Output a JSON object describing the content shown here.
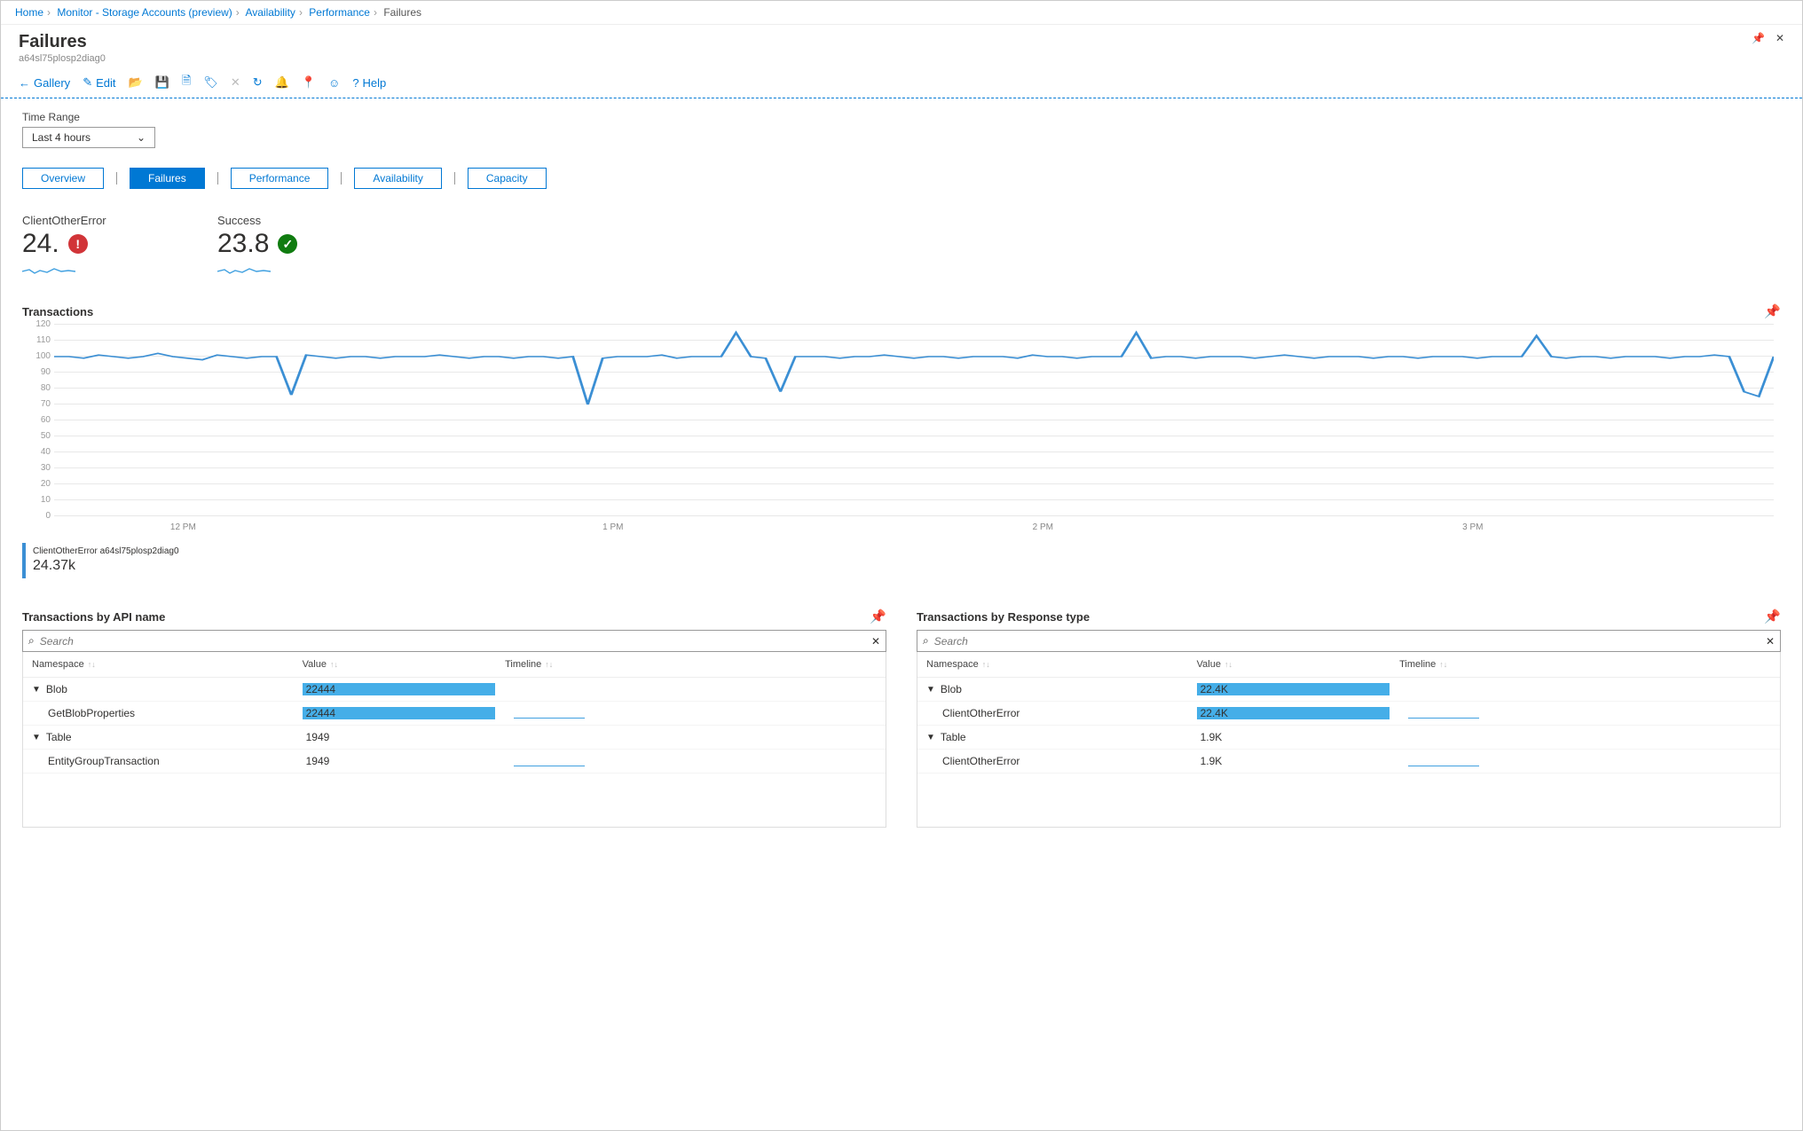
{
  "breadcrumb": [
    "Home",
    "Monitor - Storage Accounts (preview)",
    "Availability",
    "Performance",
    "Failures"
  ],
  "page": {
    "title": "Failures",
    "subtitle": "a64sl75plosp2diag0"
  },
  "toolbar": {
    "gallery": "Gallery",
    "edit": "Edit",
    "help": "Help"
  },
  "timeRange": {
    "label": "Time Range",
    "value": "Last 4 hours"
  },
  "tabs": [
    "Overview",
    "Failures",
    "Performance",
    "Availability",
    "Capacity"
  ],
  "tabs_active": "Failures",
  "kpis": [
    {
      "name": "ClientOtherError",
      "value": "24.",
      "status": "red"
    },
    {
      "name": "Success",
      "value": "23.8",
      "status": "green"
    }
  ],
  "chart_data": {
    "type": "line",
    "title": "Transactions",
    "y_ticks": [
      0,
      10,
      20,
      30,
      40,
      50,
      60,
      70,
      80,
      90,
      100,
      110,
      120
    ],
    "x_ticks": [
      "12 PM",
      "1 PM",
      "2 PM",
      "3 PM"
    ],
    "ylim": [
      0,
      120
    ],
    "series": [
      {
        "name": "ClientOtherError a64sl75plosp2diag0",
        "total": "24.37k",
        "values": [
          100,
          100,
          99,
          101,
          100,
          99,
          100,
          102,
          100,
          99,
          98,
          101,
          100,
          99,
          100,
          100,
          76,
          101,
          100,
          99,
          100,
          100,
          99,
          100,
          100,
          100,
          101,
          100,
          99,
          100,
          100,
          99,
          100,
          100,
          99,
          100,
          70,
          99,
          100,
          100,
          100,
          101,
          99,
          100,
          100,
          100,
          115,
          100,
          99,
          78,
          100,
          100,
          100,
          99,
          100,
          100,
          101,
          100,
          99,
          100,
          100,
          99,
          100,
          100,
          100,
          99,
          101,
          100,
          100,
          99,
          100,
          100,
          100,
          115,
          99,
          100,
          100,
          99,
          100,
          100,
          100,
          99,
          100,
          101,
          100,
          99,
          100,
          100,
          100,
          99,
          100,
          100,
          99,
          100,
          100,
          100,
          99,
          100,
          100,
          100,
          113,
          100,
          99,
          100,
          100,
          99,
          100,
          100,
          100,
          99,
          100,
          100,
          101,
          100,
          78,
          75,
          100
        ]
      }
    ]
  },
  "tables": {
    "api": {
      "title": "Transactions by API name",
      "headers": [
        "Namespace",
        "Value",
        "Timeline"
      ],
      "search_placeholder": "Search",
      "maxValue": 22444,
      "rows": [
        {
          "level": 0,
          "name": "Blob",
          "value": "22444",
          "bar": true
        },
        {
          "level": 1,
          "name": "GetBlobProperties",
          "value": "22444",
          "bar": true,
          "timeline": true
        },
        {
          "level": 0,
          "name": "Table",
          "value": "1949",
          "bar": false
        },
        {
          "level": 1,
          "name": "EntityGroupTransaction",
          "value": "1949",
          "bar": false,
          "timeline": true
        }
      ]
    },
    "resp": {
      "title": "Transactions by Response type",
      "headers": [
        "Namespace",
        "Value",
        "Timeline"
      ],
      "search_placeholder": "Search",
      "rows": [
        {
          "level": 0,
          "name": "Blob",
          "value": "22.4K",
          "bar": true
        },
        {
          "level": 1,
          "name": "ClientOtherError",
          "value": "22.4K",
          "bar": true,
          "timeline": true
        },
        {
          "level": 0,
          "name": "Table",
          "value": "1.9K",
          "bar": false
        },
        {
          "level": 1,
          "name": "ClientOtherError",
          "value": "1.9K",
          "bar": false,
          "timeline": true
        }
      ]
    }
  }
}
